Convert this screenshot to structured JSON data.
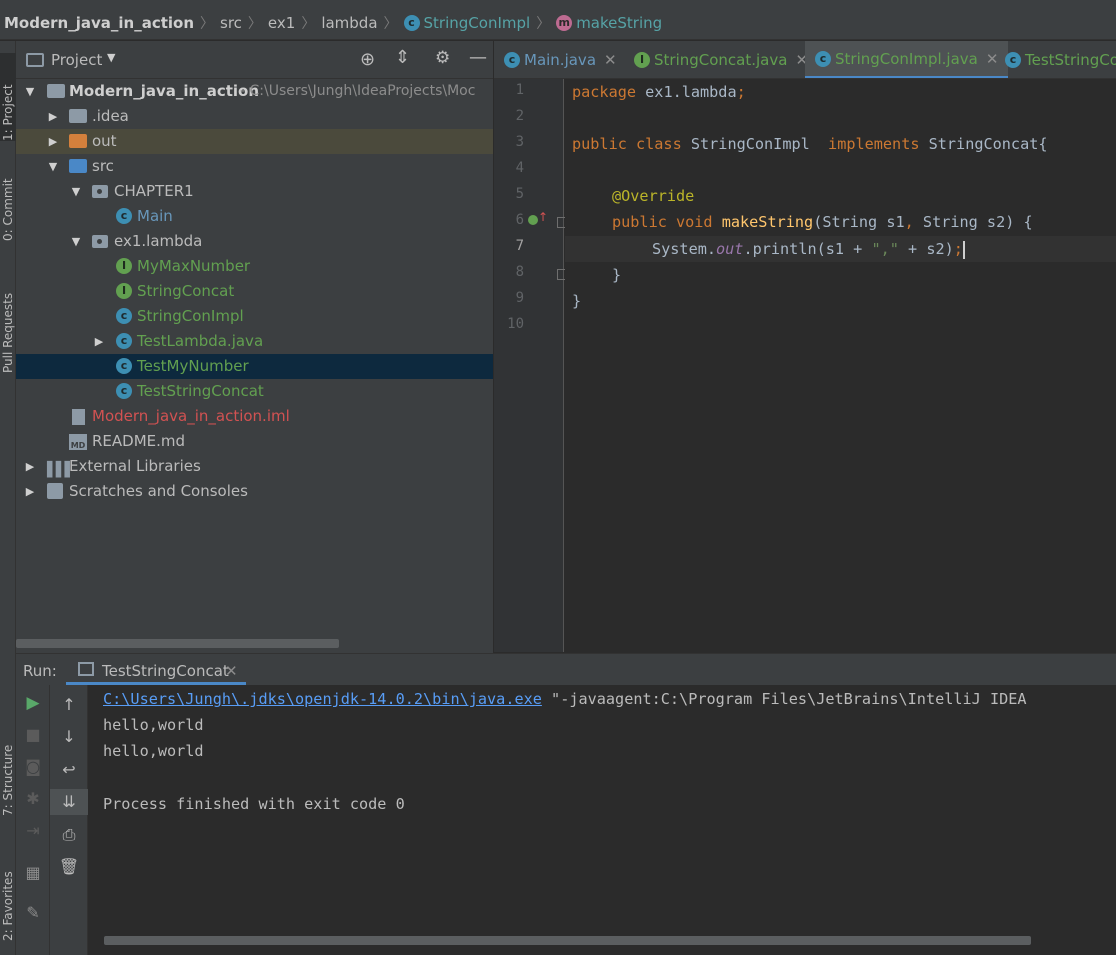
{
  "breadcrumb": {
    "project": "Modern_java_in_action",
    "src": "src",
    "pkg": "ex1",
    "subpkg": "lambda",
    "cls": "StringConImpl",
    "method": "makeString"
  },
  "sidebar_tabs": [
    "1: Project",
    "0: Commit",
    "Pull Requests",
    "7: Structure",
    "2: Favorites"
  ],
  "project_panel": {
    "title": "Project",
    "tree": [
      {
        "label": "Modern_java_in_action",
        "path": "- C:\\Users\\Jungh\\IdeaProjects\\Moc"
      },
      {
        "label": ".idea"
      },
      {
        "label": "out"
      },
      {
        "label": "src"
      },
      {
        "label": "CHAPTER1"
      },
      {
        "label": "Main"
      },
      {
        "label": "ex1.lambda"
      },
      {
        "label": "MyMaxNumber"
      },
      {
        "label": "StringConcat"
      },
      {
        "label": "StringConImpl"
      },
      {
        "label": "TestLambda.java"
      },
      {
        "label": "TestMyNumber"
      },
      {
        "label": "TestStringConcat"
      },
      {
        "label": "Modern_java_in_action.iml"
      },
      {
        "label": "README.md"
      },
      {
        "label": "External Libraries"
      },
      {
        "label": "Scratches and Consoles"
      }
    ]
  },
  "tabs": [
    {
      "label": "Main.java"
    },
    {
      "label": "StringConcat.java"
    },
    {
      "label": "StringConImpl.java"
    },
    {
      "label": "TestStringCo"
    }
  ],
  "editor": {
    "line_numbers": [
      "1",
      "2",
      "3",
      "4",
      "5",
      "6",
      "7",
      "8",
      "9",
      "10"
    ],
    "tokens": {
      "l1_kw": "package",
      "l1_rest": " ex1.lambda",
      "l1_semi": ";",
      "l3_kw1": "public class",
      "l3_name": " StringConImpl  ",
      "l3_kw2": "implements",
      "l3_rest": " StringConcat{",
      "l5_ann": "@Override",
      "l6_kw": "public void",
      "l6_fn": " makeString",
      "l6_a": "(String s1",
      "l6_comma": ",",
      "l6_b": " String s2) {",
      "l7_a": "System.",
      "l7_fld": "out",
      "l7_b": ".println(s1 + ",
      "l7_str": "\",\"",
      "l7_c": " + s2)",
      "l7_semi": ";",
      "l8": "}",
      "l9": "}"
    }
  },
  "run_panel": {
    "label": "Run:",
    "tab": "TestStringConcat",
    "console": {
      "cmd_link": "C:\\Users\\Jungh\\.jdks\\openjdk-14.0.2\\bin\\java.exe",
      "cmd_rest": " \"-javaagent:C:\\Program Files\\JetBrains\\IntelliJ IDEA",
      "lines": [
        "hello,world",
        "hello,world",
        "",
        "Process finished with exit code 0"
      ]
    }
  },
  "colors": {
    "keyword": "#cc7832",
    "annotation": "#bbb529",
    "method": "#ffc66d",
    "string": "#6a8759",
    "field": "#9876aa",
    "link": "#589df6",
    "selection": "#0d293e"
  }
}
